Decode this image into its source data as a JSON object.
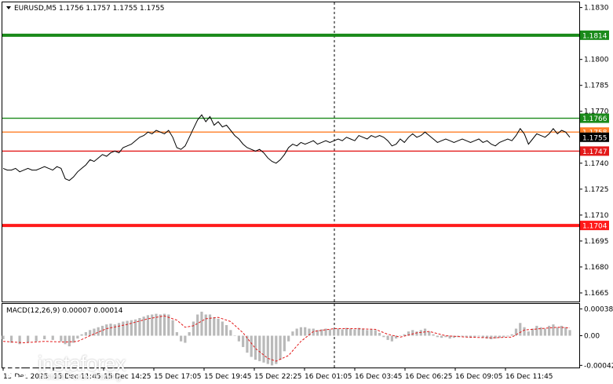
{
  "header": {
    "symbol_info": "EURUSD,M5  1.1756 1.1757 1.1755 1.1755",
    "macd_label": "MACD(12,26,9) 0.00007 0.00014"
  },
  "price_axis": {
    "ticks": [
      "1.1830",
      "1.1815",
      "1.1800",
      "1.1785",
      "1.1770",
      "1.1755",
      "1.1740",
      "1.1725",
      "1.1710",
      "1.1695",
      "1.1680",
      "1.1665"
    ],
    "tick_values": [
      1.183,
      1.1815,
      1.18,
      1.1785,
      1.177,
      1.1755,
      1.174,
      1.1725,
      1.171,
      1.1695,
      1.168,
      1.1665
    ]
  },
  "macd_axis": {
    "ticks": [
      "0.00038",
      "0.00",
      "-0.00042"
    ],
    "tick_values": [
      0.00038,
      0.0,
      -0.00042
    ]
  },
  "levels": [
    {
      "price": 1.1814,
      "label": "1.1814",
      "color": "#1a8a1a",
      "style": "thick"
    },
    {
      "price": 1.1766,
      "label": "1.1766",
      "color": "#1a8a1a",
      "style": "thin"
    },
    {
      "price": 1.1758,
      "label": "1.1758",
      "color": "#ff7f27",
      "style": "thin"
    },
    {
      "price": 1.1747,
      "label": "1.1747",
      "color": "#e31a1a",
      "style": "thin"
    },
    {
      "price": 1.1704,
      "label": "1.1704",
      "color": "#ff1a1a",
      "style": "thick"
    }
  ],
  "current_price": {
    "label": "1.1755",
    "value": 1.1755
  },
  "time_axis": {
    "labels": [
      "15 Dec 2025",
      "15 Dec 11:45",
      "15 Dec 14:25",
      "15 Dec 17:05",
      "15 Dec 19:45",
      "15 Dec 22:25",
      "16 Dec 01:05",
      "16 Dec 03:45",
      "16 Dec 06:25",
      "16 Dec 09:05",
      "16 Dec 11:45"
    ]
  },
  "brand": {
    "name": "instaforex",
    "tagline": "Instant Forex Trading"
  },
  "chart_data": {
    "type": "line",
    "symbol": "EURUSD",
    "timeframe": "M5",
    "ylim": [
      1.166,
      1.1833
    ],
    "price_path": [
      [
        0,
        1.1737
      ],
      [
        2,
        1.1736
      ],
      [
        4,
        1.1736
      ],
      [
        6,
        1.1737
      ],
      [
        8,
        1.1735
      ],
      [
        10,
        1.1736
      ],
      [
        12,
        1.1737
      ],
      [
        14,
        1.1736
      ],
      [
        16,
        1.1736
      ],
      [
        18,
        1.1737
      ],
      [
        20,
        1.1738
      ],
      [
        22,
        1.1737
      ],
      [
        24,
        1.1736
      ],
      [
        26,
        1.1738
      ],
      [
        28,
        1.1737
      ],
      [
        30,
        1.1731
      ],
      [
        32,
        1.173
      ],
      [
        34,
        1.1732
      ],
      [
        36,
        1.1735
      ],
      [
        38,
        1.1737
      ],
      [
        40,
        1.1739
      ],
      [
        42,
        1.1742
      ],
      [
        44,
        1.1741
      ],
      [
        46,
        1.1743
      ],
      [
        48,
        1.1745
      ],
      [
        50,
        1.1744
      ],
      [
        52,
        1.1746
      ],
      [
        54,
        1.1747
      ],
      [
        56,
        1.1746
      ],
      [
        58,
        1.1749
      ],
      [
        60,
        1.175
      ],
      [
        62,
        1.1751
      ],
      [
        64,
        1.1753
      ],
      [
        66,
        1.1755
      ],
      [
        68,
        1.1756
      ],
      [
        70,
        1.1758
      ],
      [
        72,
        1.1757
      ],
      [
        74,
        1.1759
      ],
      [
        76,
        1.1758
      ],
      [
        78,
        1.1757
      ],
      [
        80,
        1.1759
      ],
      [
        82,
        1.1755
      ],
      [
        84,
        1.1749
      ],
      [
        86,
        1.1748
      ],
      [
        88,
        1.175
      ],
      [
        90,
        1.1755
      ],
      [
        92,
        1.176
      ],
      [
        94,
        1.1765
      ],
      [
        96,
        1.1768
      ],
      [
        98,
        1.1764
      ],
      [
        100,
        1.1767
      ],
      [
        102,
        1.1762
      ],
      [
        104,
        1.1764
      ],
      [
        106,
        1.1761
      ],
      [
        108,
        1.1762
      ],
      [
        110,
        1.1759
      ],
      [
        112,
        1.1756
      ],
      [
        114,
        1.1754
      ],
      [
        116,
        1.1751
      ],
      [
        118,
        1.1749
      ],
      [
        120,
        1.1748
      ],
      [
        122,
        1.1747
      ],
      [
        124,
        1.1748
      ],
      [
        126,
        1.1746
      ],
      [
        128,
        1.1743
      ],
      [
        130,
        1.1741
      ],
      [
        132,
        1.174
      ],
      [
        134,
        1.1742
      ],
      [
        136,
        1.1745
      ],
      [
        138,
        1.1749
      ],
      [
        140,
        1.1751
      ],
      [
        142,
        1.175
      ],
      [
        144,
        1.1752
      ],
      [
        146,
        1.1751
      ],
      [
        148,
        1.1752
      ],
      [
        150,
        1.1753
      ],
      [
        152,
        1.1751
      ],
      [
        154,
        1.1752
      ],
      [
        156,
        1.1753
      ],
      [
        158,
        1.1752
      ],
      [
        160,
        1.1753
      ],
      [
        162,
        1.1754
      ],
      [
        164,
        1.1753
      ],
      [
        166,
        1.1755
      ],
      [
        168,
        1.1754
      ],
      [
        170,
        1.1753
      ],
      [
        172,
        1.1756
      ],
      [
        174,
        1.1755
      ],
      [
        176,
        1.1754
      ],
      [
        178,
        1.1756
      ],
      [
        180,
        1.1755
      ],
      [
        182,
        1.1756
      ],
      [
        184,
        1.1755
      ],
      [
        186,
        1.1753
      ],
      [
        188,
        1.175
      ],
      [
        190,
        1.1751
      ],
      [
        192,
        1.1754
      ],
      [
        194,
        1.1752
      ],
      [
        196,
        1.1755
      ],
      [
        198,
        1.1757
      ],
      [
        200,
        1.1755
      ],
      [
        202,
        1.1756
      ],
      [
        204,
        1.1758
      ],
      [
        206,
        1.1756
      ],
      [
        208,
        1.1754
      ],
      [
        210,
        1.1752
      ],
      [
        212,
        1.1753
      ],
      [
        214,
        1.1754
      ],
      [
        216,
        1.1753
      ],
      [
        218,
        1.1752
      ],
      [
        220,
        1.1753
      ],
      [
        222,
        1.1754
      ],
      [
        224,
        1.1753
      ],
      [
        226,
        1.1752
      ],
      [
        228,
        1.1753
      ],
      [
        230,
        1.1754
      ],
      [
        232,
        1.1752
      ],
      [
        234,
        1.1753
      ],
      [
        236,
        1.1751
      ],
      [
        238,
        1.175
      ],
      [
        240,
        1.1752
      ],
      [
        242,
        1.1753
      ],
      [
        244,
        1.1754
      ],
      [
        246,
        1.1753
      ],
      [
        248,
        1.1756
      ],
      [
        250,
        1.176
      ],
      [
        252,
        1.1757
      ],
      [
        254,
        1.1751
      ],
      [
        256,
        1.1754
      ],
      [
        258,
        1.1757
      ],
      [
        260,
        1.1756
      ],
      [
        262,
        1.1755
      ],
      [
        264,
        1.1757
      ],
      [
        266,
        1.176
      ],
      [
        268,
        1.1757
      ],
      [
        270,
        1.1759
      ],
      [
        272,
        1.1758
      ],
      [
        274,
        1.1755
      ]
    ],
    "macd": {
      "name": "MACD(12,26,9)",
      "ylim": [
        -0.00045,
        0.00045
      ],
      "histogram": [
        [
          0,
          -5e-05
        ],
        [
          4,
          -0.0001
        ],
        [
          8,
          -0.00012
        ],
        [
          12,
          -0.0001
        ],
        [
          16,
          -8e-05
        ],
        [
          20,
          -5e-05
        ],
        [
          24,
          -6e-05
        ],
        [
          28,
          -8e-05
        ],
        [
          30,
          -0.00012
        ],
        [
          32,
          -0.00015
        ],
        [
          34,
          -0.0001
        ],
        [
          36,
          -4e-05
        ],
        [
          38,
          2e-05
        ],
        [
          40,
          5e-05
        ],
        [
          42,
          8e-05
        ],
        [
          44,
          0.0001
        ],
        [
          46,
          0.00012
        ],
        [
          48,
          0.00014
        ],
        [
          50,
          0.00016
        ],
        [
          52,
          0.00017
        ],
        [
          54,
          0.00016
        ],
        [
          56,
          0.00018
        ],
        [
          58,
          0.0002
        ],
        [
          60,
          0.00021
        ],
        [
          62,
          0.00022
        ],
        [
          64,
          0.00023
        ],
        [
          66,
          0.00025
        ],
        [
          68,
          0.00027
        ],
        [
          70,
          0.00029
        ],
        [
          72,
          0.0003
        ],
        [
          74,
          0.00031
        ],
        [
          76,
          0.0003
        ],
        [
          78,
          0.00031
        ],
        [
          80,
          0.0003
        ],
        [
          82,
          0.00022
        ],
        [
          84,
          5e-05
        ],
        [
          86,
          -8e-05
        ],
        [
          88,
          -0.0001
        ],
        [
          90,
          5e-05
        ],
        [
          92,
          0.0002
        ],
        [
          94,
          0.0003
        ],
        [
          96,
          0.00034
        ],
        [
          98,
          0.0003
        ],
        [
          100,
          0.0003
        ],
        [
          102,
          0.00026
        ],
        [
          104,
          0.00024
        ],
        [
          106,
          0.0002
        ],
        [
          108,
          0.00015
        ],
        [
          110,
          8e-05
        ],
        [
          112,
          0.0
        ],
        [
          114,
          -8e-05
        ],
        [
          116,
          -0.00016
        ],
        [
          118,
          -0.00024
        ],
        [
          120,
          -0.0003
        ],
        [
          122,
          -0.00034
        ],
        [
          124,
          -0.00036
        ],
        [
          126,
          -0.00038
        ],
        [
          128,
          -0.0004
        ],
        [
          130,
          -0.00042
        ],
        [
          132,
          -0.0004
        ],
        [
          134,
          -0.00034
        ],
        [
          136,
          -0.00022
        ],
        [
          138,
          -8e-05
        ],
        [
          140,
          6e-05
        ],
        [
          142,
          0.0001
        ],
        [
          144,
          0.00012
        ],
        [
          146,
          0.00012
        ],
        [
          148,
          0.0001
        ],
        [
          150,
          0.0001
        ],
        [
          152,
          8e-05
        ],
        [
          154,
          9e-05
        ],
        [
          156,
          0.0001
        ],
        [
          158,
          9e-05
        ],
        [
          160,
          0.0001
        ],
        [
          162,
          0.0001
        ],
        [
          164,
          9e-05
        ],
        [
          166,
          0.00011
        ],
        [
          168,
          0.0001
        ],
        [
          170,
          9e-05
        ],
        [
          172,
          0.00011
        ],
        [
          174,
          0.0001
        ],
        [
          176,
          8e-05
        ],
        [
          178,
          9e-05
        ],
        [
          180,
          8e-05
        ],
        [
          182,
          4e-05
        ],
        [
          184,
          -2e-05
        ],
        [
          186,
          -6e-05
        ],
        [
          188,
          -8e-05
        ],
        [
          190,
          -4e-05
        ],
        [
          192,
          0.0
        ],
        [
          194,
          2e-05
        ],
        [
          196,
          6e-05
        ],
        [
          198,
          8e-05
        ],
        [
          200,
          6e-05
        ],
        [
          202,
          8e-05
        ],
        [
          204,
          0.0001
        ],
        [
          206,
          6e-05
        ],
        [
          208,
          2e-05
        ],
        [
          210,
          -2e-05
        ],
        [
          212,
          -3e-05
        ],
        [
          214,
          -2e-05
        ],
        [
          216,
          -4e-05
        ],
        [
          218,
          -3e-05
        ],
        [
          220,
          -2e-05
        ],
        [
          222,
          -1e-05
        ],
        [
          224,
          -2e-05
        ],
        [
          226,
          -3e-05
        ],
        [
          228,
          -2e-05
        ],
        [
          230,
          -1e-05
        ],
        [
          232,
          -3e-05
        ],
        [
          234,
          -4e-05
        ],
        [
          236,
          -5e-05
        ],
        [
          238,
          -4e-05
        ],
        [
          240,
          -3e-05
        ],
        [
          242,
          -2e-05
        ],
        [
          244,
          -1e-05
        ],
        [
          246,
          2e-05
        ],
        [
          248,
          0.0001
        ],
        [
          250,
          0.00018
        ],
        [
          252,
          0.00012
        ],
        [
          254,
          6e-05
        ],
        [
          256,
          0.0001
        ],
        [
          258,
          0.00014
        ],
        [
          260,
          0.00012
        ],
        [
          262,
          0.0001
        ],
        [
          264,
          0.00014
        ],
        [
          266,
          0.00016
        ],
        [
          268,
          0.00012
        ],
        [
          270,
          0.00014
        ],
        [
          272,
          0.00012
        ],
        [
          274,
          8e-05
        ]
      ],
      "signal": [
        [
          0,
          -8e-05
        ],
        [
          10,
          -0.0001
        ],
        [
          20,
          -8e-05
        ],
        [
          30,
          -9e-05
        ],
        [
          36,
          -8e-05
        ],
        [
          42,
          0.0
        ],
        [
          50,
          0.0001
        ],
        [
          60,
          0.00016
        ],
        [
          70,
          0.00024
        ],
        [
          78,
          0.00028
        ],
        [
          84,
          0.00022
        ],
        [
          88,
          0.00012
        ],
        [
          92,
          0.00014
        ],
        [
          98,
          0.00024
        ],
        [
          104,
          0.00026
        ],
        [
          110,
          0.0002
        ],
        [
          116,
          4e-05
        ],
        [
          122,
          -0.00018
        ],
        [
          128,
          -0.00032
        ],
        [
          132,
          -0.00036
        ],
        [
          138,
          -0.00028
        ],
        [
          144,
          -8e-05
        ],
        [
          150,
          6e-05
        ],
        [
          160,
          0.0001
        ],
        [
          170,
          0.0001
        ],
        [
          180,
          9e-05
        ],
        [
          186,
          2e-05
        ],
        [
          192,
          -2e-05
        ],
        [
          200,
          4e-05
        ],
        [
          206,
          6e-05
        ],
        [
          214,
          0.0
        ],
        [
          224,
          -2e-05
        ],
        [
          236,
          -3e-05
        ],
        [
          246,
          -2e-05
        ],
        [
          252,
          8e-05
        ],
        [
          260,
          0.0001
        ],
        [
          268,
          0.00012
        ],
        [
          274,
          0.00011
        ]
      ]
    }
  }
}
